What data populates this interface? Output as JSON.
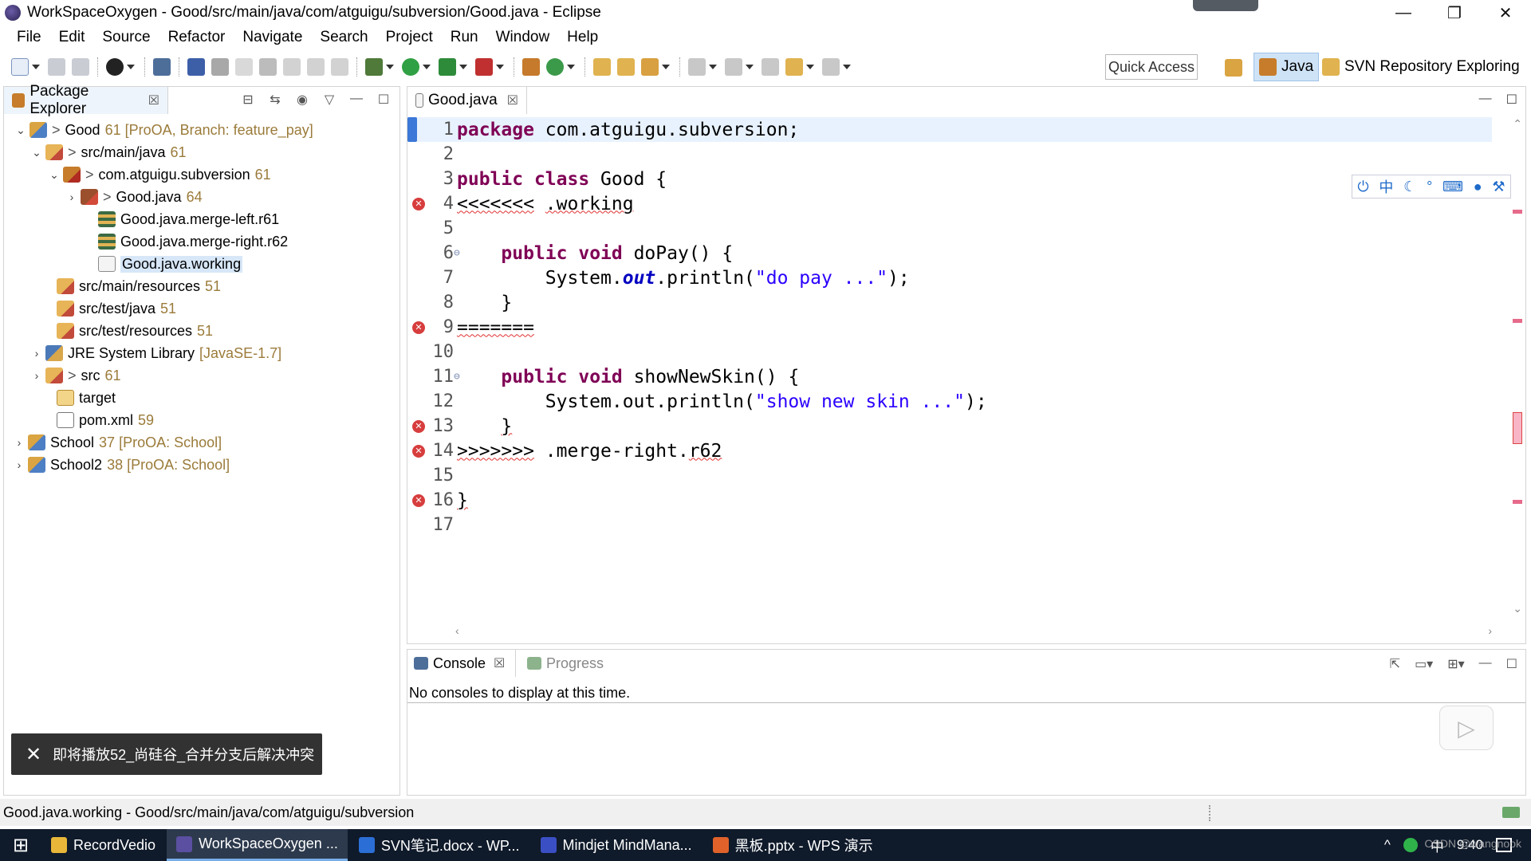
{
  "window": {
    "title": "WorkSpaceOxygen - Good/src/main/java/com/atguigu/subversion/Good.java - Eclipse",
    "controls": {
      "minimize": "—",
      "maximize": "❐",
      "close": "✕"
    }
  },
  "menu": [
    "File",
    "Edit",
    "Source",
    "Refactor",
    "Navigate",
    "Search",
    "Project",
    "Run",
    "Window",
    "Help"
  ],
  "toolbar": {
    "quick_access": "Quick Access",
    "perspectives": [
      {
        "label": "Java",
        "active": true
      },
      {
        "label": "SVN Repository Exploring",
        "active": false
      }
    ]
  },
  "package_explorer": {
    "tab_label": "Package Explorer",
    "tab_close": "☒",
    "tree": [
      {
        "twisty": "⌄",
        "icon": "project",
        "prefix": ">",
        "label": "Good",
        "dec": "61 [ProOA, Branch: feature_pay]"
      },
      {
        "twisty": "⌄",
        "icon": "srcfolder",
        "prefix": ">",
        "label": "src/main/java",
        "dec": "61"
      },
      {
        "twisty": "⌄",
        "icon": "package",
        "prefix": ">",
        "label": "com.atguigu.subversion",
        "dec": "61"
      },
      {
        "twisty": "›",
        "icon": "java",
        "prefix": ">",
        "label": "Good.java",
        "dec": "64"
      },
      {
        "twisty": "",
        "icon": "merge",
        "prefix": "",
        "label": "Good.java.merge-left.r61",
        "dec": ""
      },
      {
        "twisty": "",
        "icon": "merge",
        "prefix": "",
        "label": "Good.java.merge-right.r62",
        "dec": ""
      },
      {
        "twisty": "",
        "icon": "file",
        "prefix": "",
        "label": "Good.java.working",
        "dec": "",
        "selected": true
      },
      {
        "twisty": "",
        "icon": "srcfolder",
        "prefix": "",
        "label": "src/main/resources",
        "dec": "51"
      },
      {
        "twisty": "",
        "icon": "srcfolder",
        "prefix": "",
        "label": "src/test/java",
        "dec": "51"
      },
      {
        "twisty": "",
        "icon": "srcfolder",
        "prefix": "",
        "label": "src/test/resources",
        "dec": "51"
      },
      {
        "twisty": "›",
        "icon": "jre",
        "prefix": "",
        "label": "JRE System Library",
        "dec": "[JavaSE-1.7]"
      },
      {
        "twisty": "›",
        "icon": "srcfolder",
        "prefix": ">",
        "label": "src",
        "dec": "61"
      },
      {
        "twisty": "",
        "icon": "folder",
        "prefix": "",
        "label": "target",
        "dec": ""
      },
      {
        "twisty": "",
        "icon": "xml",
        "prefix": "",
        "label": "pom.xml",
        "dec": "59"
      },
      {
        "twisty": "›",
        "icon": "project",
        "prefix": "",
        "label": "School",
        "dec": "37 [ProOA: School]"
      },
      {
        "twisty": "›",
        "icon": "project",
        "prefix": "",
        "label": "School2",
        "dec": "38 [ProOA: School]"
      }
    ]
  },
  "editor": {
    "tab_label": "Good.java",
    "tab_close": "☒",
    "lines": [
      {
        "n": "1",
        "mark": "current",
        "fold": "",
        "html": "<span class=\"kw\">package</span> com.atguigu.subversion;"
      },
      {
        "n": "2",
        "mark": "",
        "fold": "",
        "html": ""
      },
      {
        "n": "3",
        "mark": "",
        "fold": "",
        "html": "<span class=\"kw\">public</span> <span class=\"kw\">class</span> Good {"
      },
      {
        "n": "4",
        "mark": "error",
        "fold": "",
        "html": "<span class=\"squig\">&lt;&lt;&lt;&lt;&lt;&lt;&lt;</span> <span class=\"squig\">.working</span>"
      },
      {
        "n": "5",
        "mark": "",
        "fold": "",
        "html": ""
      },
      {
        "n": "6",
        "mark": "",
        "fold": "⊖",
        "html": "    <span class=\"kw\">public</span> <span class=\"kw\">void</span> doPay() {"
      },
      {
        "n": "7",
        "mark": "",
        "fold": "",
        "html": "        System.<span class=\"fld\">out</span>.println(<span class=\"str\">\"do pay ...\"</span>);"
      },
      {
        "n": "8",
        "mark": "",
        "fold": "",
        "html": "    }"
      },
      {
        "n": "9",
        "mark": "error",
        "fold": "",
        "html": "<span class=\"squig\">=======</span>"
      },
      {
        "n": "10",
        "mark": "",
        "fold": "",
        "html": ""
      },
      {
        "n": "11",
        "mark": "",
        "fold": "⊖",
        "html": "    <span class=\"kw\">public</span> <span class=\"kw\">void</span> showNewSkin() {"
      },
      {
        "n": "12",
        "mark": "",
        "fold": "",
        "html": "        System.out.println(<span class=\"str\">\"show new skin ...\"</span>);"
      },
      {
        "n": "13",
        "mark": "error",
        "fold": "",
        "html": "    <span class=\"squig\">}</span>"
      },
      {
        "n": "14",
        "mark": "error",
        "fold": "",
        "html": "<span class=\"squig\">&gt;&gt;&gt;&gt;&gt;&gt;&gt;</span> .merge-right.<span class=\"squig\">r62</span>"
      },
      {
        "n": "15",
        "mark": "",
        "fold": "",
        "html": ""
      },
      {
        "n": "16",
        "mark": "error",
        "fold": "",
        "html": "<span class=\"squig\">}</span>"
      },
      {
        "n": "17",
        "mark": "",
        "fold": "",
        "html": ""
      }
    ]
  },
  "console": {
    "tab_label": "Console",
    "tab_close": "☒",
    "progress_label": "Progress",
    "message": "No consoles to display at this time."
  },
  "toast": {
    "close": "✕",
    "text": "即将播放52_尚硅谷_合并分支后解决冲突"
  },
  "status_bar": {
    "text": "Good.java.working - Good/src/main/java/com/atguigu/subversion"
  },
  "taskbar": {
    "items": [
      {
        "label": "RecordVedio",
        "color": "#e8b73a",
        "active": false
      },
      {
        "label": "WorkSpaceOxygen ...",
        "color": "#5a4fa0",
        "active": true
      },
      {
        "label": "SVN笔记.docx - WP...",
        "color": "#2b6fd6",
        "active": false
      },
      {
        "label": "Mindjet MindMana...",
        "color": "#3b4fc4",
        "active": false
      },
      {
        "label": "黑板.pptx - WPS 演示",
        "color": "#e0622a",
        "active": false
      }
    ],
    "tray": {
      "caret": "^",
      "ime": "中",
      "clock": "9:40"
    }
  },
  "watermark": "CSDN @wangnook",
  "colors": {
    "keyword": "#7f0055",
    "string": "#2a00ff",
    "field": "#0000c0",
    "error": "#d73d3d",
    "selection": "#d7e7f8",
    "taskbar": "#0f1a2a"
  }
}
